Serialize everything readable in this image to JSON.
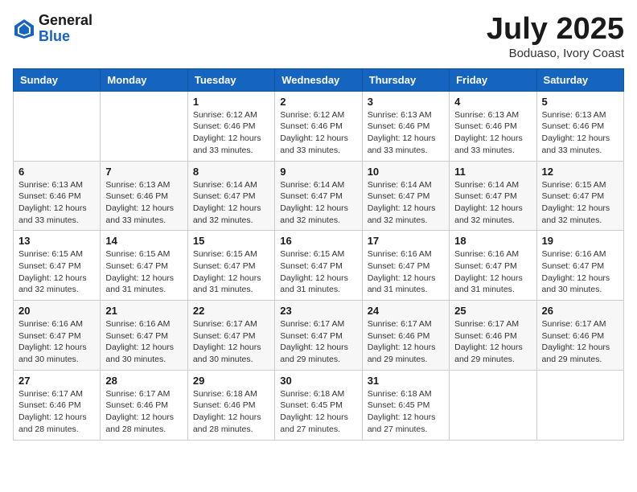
{
  "header": {
    "logo_general": "General",
    "logo_blue": "Blue",
    "month_title": "July 2025",
    "location": "Boduaso, Ivory Coast"
  },
  "days_of_week": [
    "Sunday",
    "Monday",
    "Tuesday",
    "Wednesday",
    "Thursday",
    "Friday",
    "Saturday"
  ],
  "weeks": [
    [
      {
        "day": "",
        "info": ""
      },
      {
        "day": "",
        "info": ""
      },
      {
        "day": "1",
        "info": "Sunrise: 6:12 AM\nSunset: 6:46 PM\nDaylight: 12 hours and 33 minutes."
      },
      {
        "day": "2",
        "info": "Sunrise: 6:12 AM\nSunset: 6:46 PM\nDaylight: 12 hours and 33 minutes."
      },
      {
        "day": "3",
        "info": "Sunrise: 6:13 AM\nSunset: 6:46 PM\nDaylight: 12 hours and 33 minutes."
      },
      {
        "day": "4",
        "info": "Sunrise: 6:13 AM\nSunset: 6:46 PM\nDaylight: 12 hours and 33 minutes."
      },
      {
        "day": "5",
        "info": "Sunrise: 6:13 AM\nSunset: 6:46 PM\nDaylight: 12 hours and 33 minutes."
      }
    ],
    [
      {
        "day": "6",
        "info": "Sunrise: 6:13 AM\nSunset: 6:46 PM\nDaylight: 12 hours and 33 minutes."
      },
      {
        "day": "7",
        "info": "Sunrise: 6:13 AM\nSunset: 6:46 PM\nDaylight: 12 hours and 33 minutes."
      },
      {
        "day": "8",
        "info": "Sunrise: 6:14 AM\nSunset: 6:47 PM\nDaylight: 12 hours and 32 minutes."
      },
      {
        "day": "9",
        "info": "Sunrise: 6:14 AM\nSunset: 6:47 PM\nDaylight: 12 hours and 32 minutes."
      },
      {
        "day": "10",
        "info": "Sunrise: 6:14 AM\nSunset: 6:47 PM\nDaylight: 12 hours and 32 minutes."
      },
      {
        "day": "11",
        "info": "Sunrise: 6:14 AM\nSunset: 6:47 PM\nDaylight: 12 hours and 32 minutes."
      },
      {
        "day": "12",
        "info": "Sunrise: 6:15 AM\nSunset: 6:47 PM\nDaylight: 12 hours and 32 minutes."
      }
    ],
    [
      {
        "day": "13",
        "info": "Sunrise: 6:15 AM\nSunset: 6:47 PM\nDaylight: 12 hours and 32 minutes."
      },
      {
        "day": "14",
        "info": "Sunrise: 6:15 AM\nSunset: 6:47 PM\nDaylight: 12 hours and 31 minutes."
      },
      {
        "day": "15",
        "info": "Sunrise: 6:15 AM\nSunset: 6:47 PM\nDaylight: 12 hours and 31 minutes."
      },
      {
        "day": "16",
        "info": "Sunrise: 6:15 AM\nSunset: 6:47 PM\nDaylight: 12 hours and 31 minutes."
      },
      {
        "day": "17",
        "info": "Sunrise: 6:16 AM\nSunset: 6:47 PM\nDaylight: 12 hours and 31 minutes."
      },
      {
        "day": "18",
        "info": "Sunrise: 6:16 AM\nSunset: 6:47 PM\nDaylight: 12 hours and 31 minutes."
      },
      {
        "day": "19",
        "info": "Sunrise: 6:16 AM\nSunset: 6:47 PM\nDaylight: 12 hours and 30 minutes."
      }
    ],
    [
      {
        "day": "20",
        "info": "Sunrise: 6:16 AM\nSunset: 6:47 PM\nDaylight: 12 hours and 30 minutes."
      },
      {
        "day": "21",
        "info": "Sunrise: 6:16 AM\nSunset: 6:47 PM\nDaylight: 12 hours and 30 minutes."
      },
      {
        "day": "22",
        "info": "Sunrise: 6:17 AM\nSunset: 6:47 PM\nDaylight: 12 hours and 30 minutes."
      },
      {
        "day": "23",
        "info": "Sunrise: 6:17 AM\nSunset: 6:47 PM\nDaylight: 12 hours and 29 minutes."
      },
      {
        "day": "24",
        "info": "Sunrise: 6:17 AM\nSunset: 6:46 PM\nDaylight: 12 hours and 29 minutes."
      },
      {
        "day": "25",
        "info": "Sunrise: 6:17 AM\nSunset: 6:46 PM\nDaylight: 12 hours and 29 minutes."
      },
      {
        "day": "26",
        "info": "Sunrise: 6:17 AM\nSunset: 6:46 PM\nDaylight: 12 hours and 29 minutes."
      }
    ],
    [
      {
        "day": "27",
        "info": "Sunrise: 6:17 AM\nSunset: 6:46 PM\nDaylight: 12 hours and 28 minutes."
      },
      {
        "day": "28",
        "info": "Sunrise: 6:17 AM\nSunset: 6:46 PM\nDaylight: 12 hours and 28 minutes."
      },
      {
        "day": "29",
        "info": "Sunrise: 6:18 AM\nSunset: 6:46 PM\nDaylight: 12 hours and 28 minutes."
      },
      {
        "day": "30",
        "info": "Sunrise: 6:18 AM\nSunset: 6:45 PM\nDaylight: 12 hours and 27 minutes."
      },
      {
        "day": "31",
        "info": "Sunrise: 6:18 AM\nSunset: 6:45 PM\nDaylight: 12 hours and 27 minutes."
      },
      {
        "day": "",
        "info": ""
      },
      {
        "day": "",
        "info": ""
      }
    ]
  ]
}
